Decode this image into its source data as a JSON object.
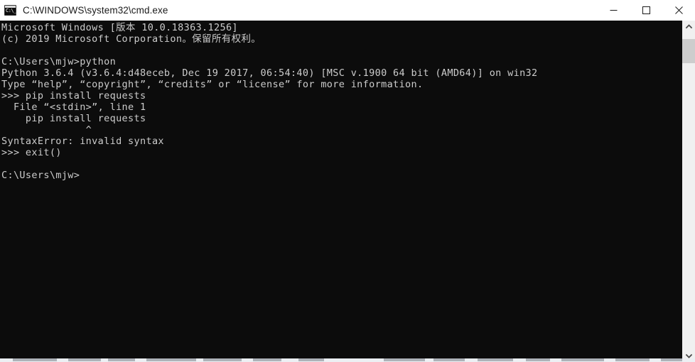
{
  "window": {
    "title": "C:\\WINDOWS\\system32\\cmd.exe",
    "icon": "cmd-icon",
    "icon_glyph": "C:\\_",
    "titlebar_bg": "#ffffff",
    "title_color": "#1a1a1a",
    "controls": {
      "minimize_label": "Minimize",
      "maximize_label": "Maximize",
      "close_label": "Close"
    }
  },
  "console": {
    "background": "#0c0c0c",
    "foreground": "#cccccc",
    "text": "Microsoft Windows [版本 10.0.18363.1256]\n(c) 2019 Microsoft Corporation。保留所有权利。\n\nC:\\Users\\mjw>python\nPython 3.6.4 (v3.6.4:d48eceb, Dec 19 2017, 06:54:40) [MSC v.1900 64 bit (AMD64)] on win32\nType “help”, “copyright”, “credits” or “license” for more information.\n>>> pip install requests\n  File “<stdin>”, line 1\n    pip install requests\n              ^\nSyntaxError: invalid syntax\n>>> exit()\n\nC:\\Users\\mjw>",
    "lines": [
      "Microsoft Windows [版本 10.0.18363.1256]",
      "(c) 2019 Microsoft Corporation。保留所有权利。",
      "",
      "C:\\Users\\mjw>python",
      "Python 3.6.4 (v3.6.4:d48eceb, Dec 19 2017, 06:54:40) [MSC v.1900 64 bit (AMD64)] on win32",
      "Type “help”, “copyright”, “credits” or “license” for more information.",
      ">>> pip install requests",
      "  File “<stdin>”, line 1",
      "    pip install requests",
      "              ^",
      "SyntaxError: invalid syntax",
      ">>> exit()",
      "",
      "C:\\Users\\mjw>"
    ],
    "prompt": "C:\\Users\\mjw>",
    "python_prompt": ">>>",
    "command_entered": "python",
    "python_version": "Python 3.6.4",
    "error": "SyntaxError: invalid syntax"
  },
  "scrollbar": {
    "up_arrow": "chevron-up-icon",
    "down_arrow": "chevron-down-icon",
    "track_color": "#f0f0f0",
    "thumb_color": "#cdcdcd"
  }
}
